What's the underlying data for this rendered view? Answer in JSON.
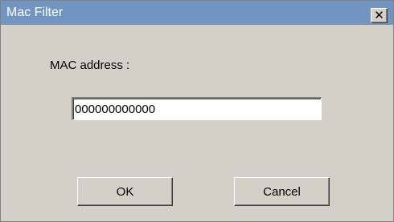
{
  "window": {
    "title": "Mac Filter",
    "close_glyph": "✕",
    "titlebar_color": "#7195c0",
    "background_color": "#d4d0c8"
  },
  "form": {
    "mac_label": "MAC address :",
    "mac_value": "000000000000"
  },
  "buttons": {
    "ok_label": "OK",
    "cancel_label": "Cancel"
  }
}
